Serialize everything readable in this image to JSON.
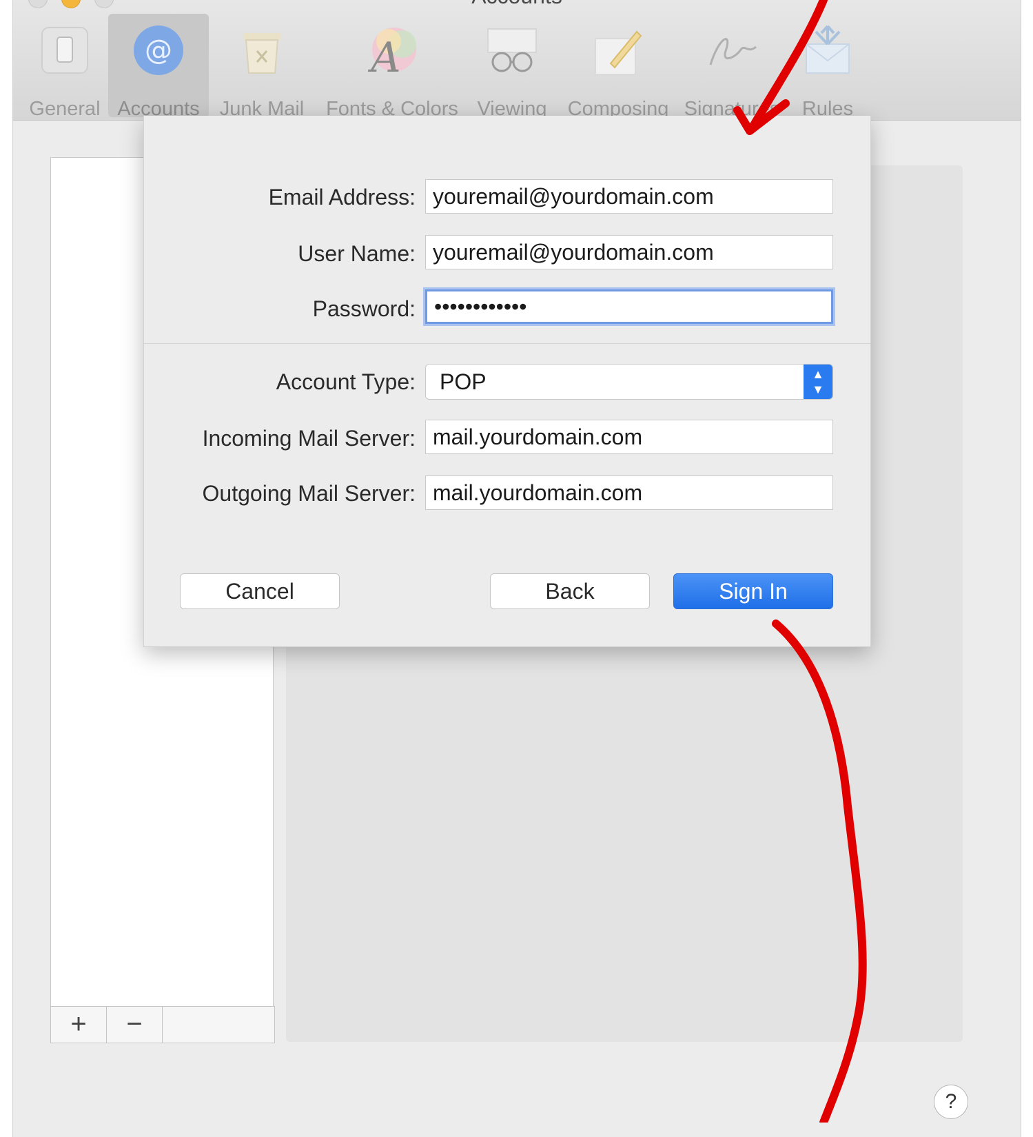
{
  "window": {
    "title": "Accounts"
  },
  "toolbar": {
    "items": [
      {
        "label": "General",
        "icon": "general-switch-icon"
      },
      {
        "label": "Accounts",
        "icon": "at-sign-icon",
        "selected": true
      },
      {
        "label": "Junk Mail",
        "icon": "junk-mail-icon"
      },
      {
        "label": "Fonts & Colors",
        "icon": "fonts-colors-icon"
      },
      {
        "label": "Viewing",
        "icon": "glasses-icon"
      },
      {
        "label": "Composing",
        "icon": "pencil-icon"
      },
      {
        "label": "Signatures",
        "icon": "signature-icon"
      },
      {
        "label": "Rules",
        "icon": "rules-envelope-icon"
      }
    ]
  },
  "sheet": {
    "email_label": "Email Address:",
    "email_value": "youremail@yourdomain.com",
    "username_label": "User Name:",
    "username_value": "youremail@yourdomain.com",
    "password_label": "Password:",
    "password_value": "••••••••••••",
    "account_type_label": "Account Type:",
    "account_type_value": "POP",
    "incoming_label": "Incoming Mail Server:",
    "incoming_value": "mail.yourdomain.com",
    "outgoing_label": "Outgoing Mail Server:",
    "outgoing_value": "mail.yourdomain.com",
    "cancel_label": "Cancel",
    "back_label": "Back",
    "sign_in_label": "Sign In"
  },
  "list_controls": {
    "add_label": "+",
    "remove_label": "−"
  },
  "help_label": "?",
  "colors": {
    "accent": "#2b7bf0",
    "annotation": "#e00000"
  }
}
